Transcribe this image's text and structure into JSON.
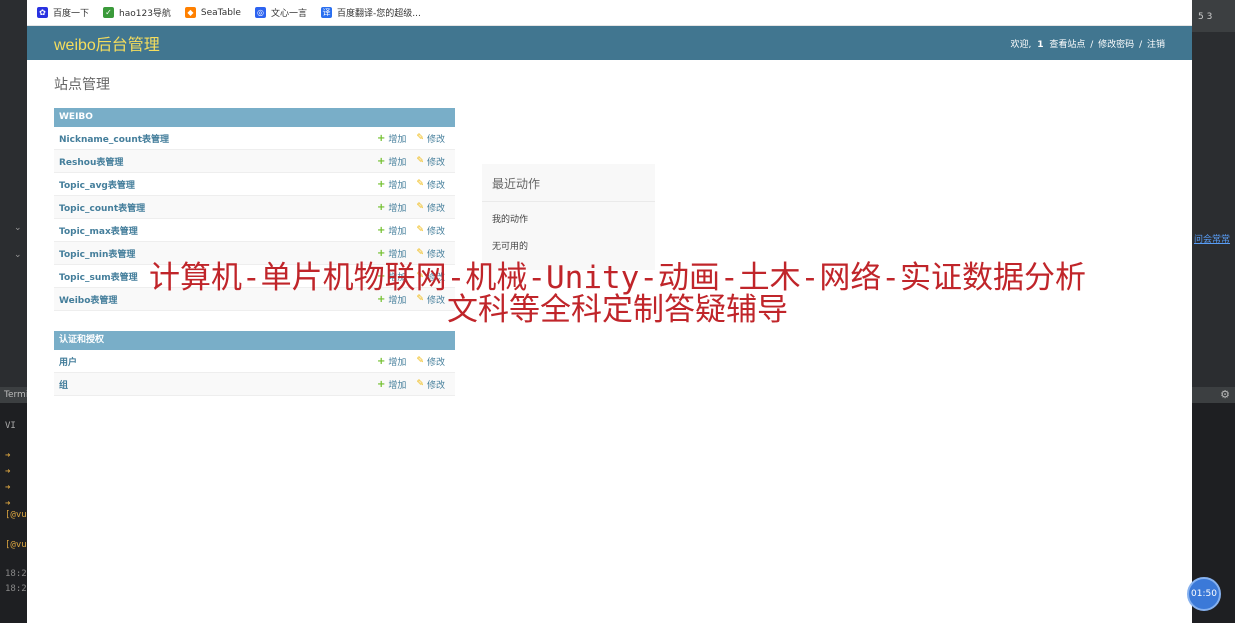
{
  "bookmarks": [
    {
      "label": "百度一下",
      "icon": "baidu-paw-icon",
      "color": "#2932e1"
    },
    {
      "label": "hao123导航",
      "icon": "hao123-icon",
      "color": "#3a9a3a"
    },
    {
      "label": "SeaTable",
      "icon": "seatable-icon",
      "color": "#ff8000"
    },
    {
      "label": "文心一言",
      "icon": "wenxin-icon",
      "color": "#2d63f0"
    },
    {
      "label": "百度翻译-您的超级...",
      "icon": "translate-icon",
      "color": "#2a6ff0"
    }
  ],
  "header": {
    "brand": "weibo后台管理",
    "welcome": "欢迎,",
    "username": "1",
    "view_site": "查看站点",
    "change_password": "修改密码",
    "logout": "注销",
    "separator": "/"
  },
  "page_title": "站点管理",
  "modules": [
    {
      "caption": "WEIBO",
      "rows": [
        {
          "name": "Nickname_count表管理",
          "add": "增加",
          "change": "修改"
        },
        {
          "name": "Reshou表管理",
          "add": "增加",
          "change": "修改"
        },
        {
          "name": "Topic_avg表管理",
          "add": "增加",
          "change": "修改"
        },
        {
          "name": "Topic_count表管理",
          "add": "增加",
          "change": "修改"
        },
        {
          "name": "Topic_max表管理",
          "add": "增加",
          "change": "修改"
        },
        {
          "name": "Topic_min表管理",
          "add": "增加",
          "change": "修改"
        },
        {
          "name": "Topic_sum表管理",
          "add": "增加",
          "change": "修改"
        },
        {
          "name": "Weibo表管理",
          "add": "增加",
          "change": "修改"
        }
      ]
    },
    {
      "caption": "认证和授权",
      "rows": [
        {
          "name": "用户",
          "add": "增加",
          "change": "修改"
        },
        {
          "name": "组",
          "add": "增加",
          "change": "修改"
        }
      ]
    }
  ],
  "recent_actions": {
    "title": "最近动作",
    "subtitle": "我的动作",
    "empty": "无可用的"
  },
  "watermark": {
    "line1": "计算机-单片机物联网-机械-Unity-动画-土木-网络-实证数据分析",
    "line2": "文科等全科定制答疑辅导"
  },
  "timer": "01:50",
  "ide": {
    "terminal_tab": "Termi",
    "right_top": "5  3",
    "right_link": "问会常常",
    "lines": [
      "VI",
      "[@vu",
      "[@vu",
      "18:2",
      "18:2"
    ]
  }
}
